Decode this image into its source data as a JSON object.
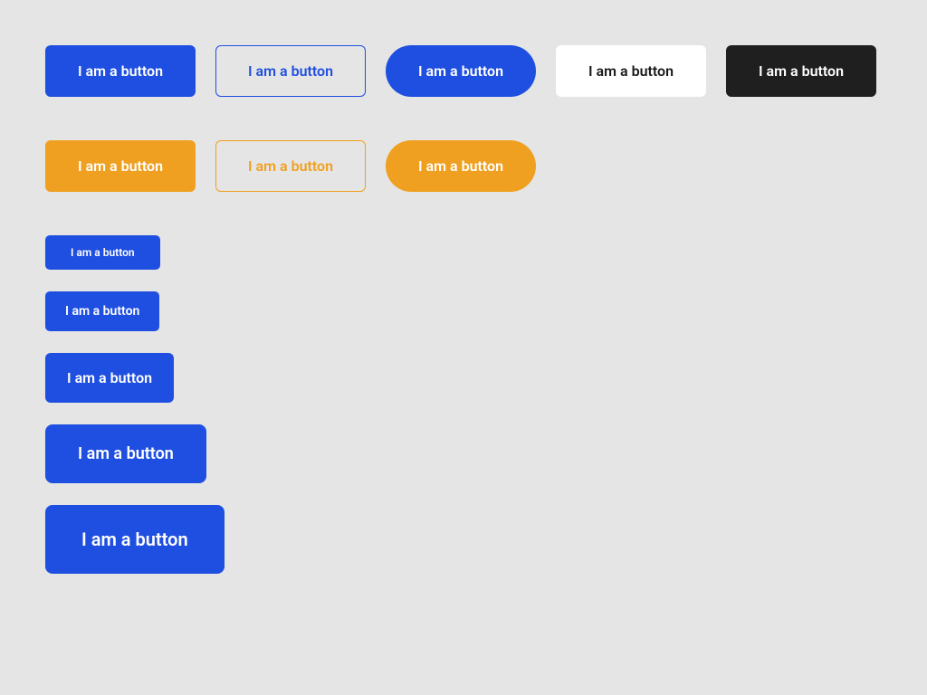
{
  "colors": {
    "blue": "#1f4fe0",
    "orange": "#f0a020",
    "dark": "#1f1f1f",
    "white": "#ffffff",
    "background": "#e5e5e5"
  },
  "row1": {
    "blue_filled": "I am a button",
    "blue_outline": "I am a button",
    "blue_pill": "I am a button",
    "white": "I am a button",
    "dark": "I am a button"
  },
  "row2": {
    "orange_filled": "I am a button",
    "orange_outline": "I am a button",
    "orange_pill": "I am a button"
  },
  "sizes": {
    "xs": "I am a button",
    "sm": "I am a button",
    "md": "I am a button",
    "lg": "I am a button",
    "xl": "I am a button"
  }
}
